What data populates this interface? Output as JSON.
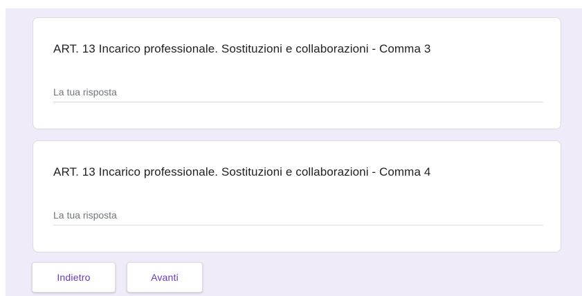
{
  "questions": [
    {
      "title": "ART. 13 Incarico professionale. Sostituzioni e collaborazioni - Comma 3",
      "answer_value": "",
      "answer_placeholder": "La tua risposta"
    },
    {
      "title": "ART. 13 Incarico professionale. Sostituzioni e collaborazioni - Comma 4",
      "answer_value": "",
      "answer_placeholder": "La tua risposta"
    }
  ],
  "navigation": {
    "back_label": "Indietro",
    "next_label": "Avanti"
  },
  "colors": {
    "page_background": "#efebf8",
    "accent": "#673ab7",
    "card_border": "#dadce0",
    "text": "#202124",
    "placeholder": "#70757a"
  }
}
